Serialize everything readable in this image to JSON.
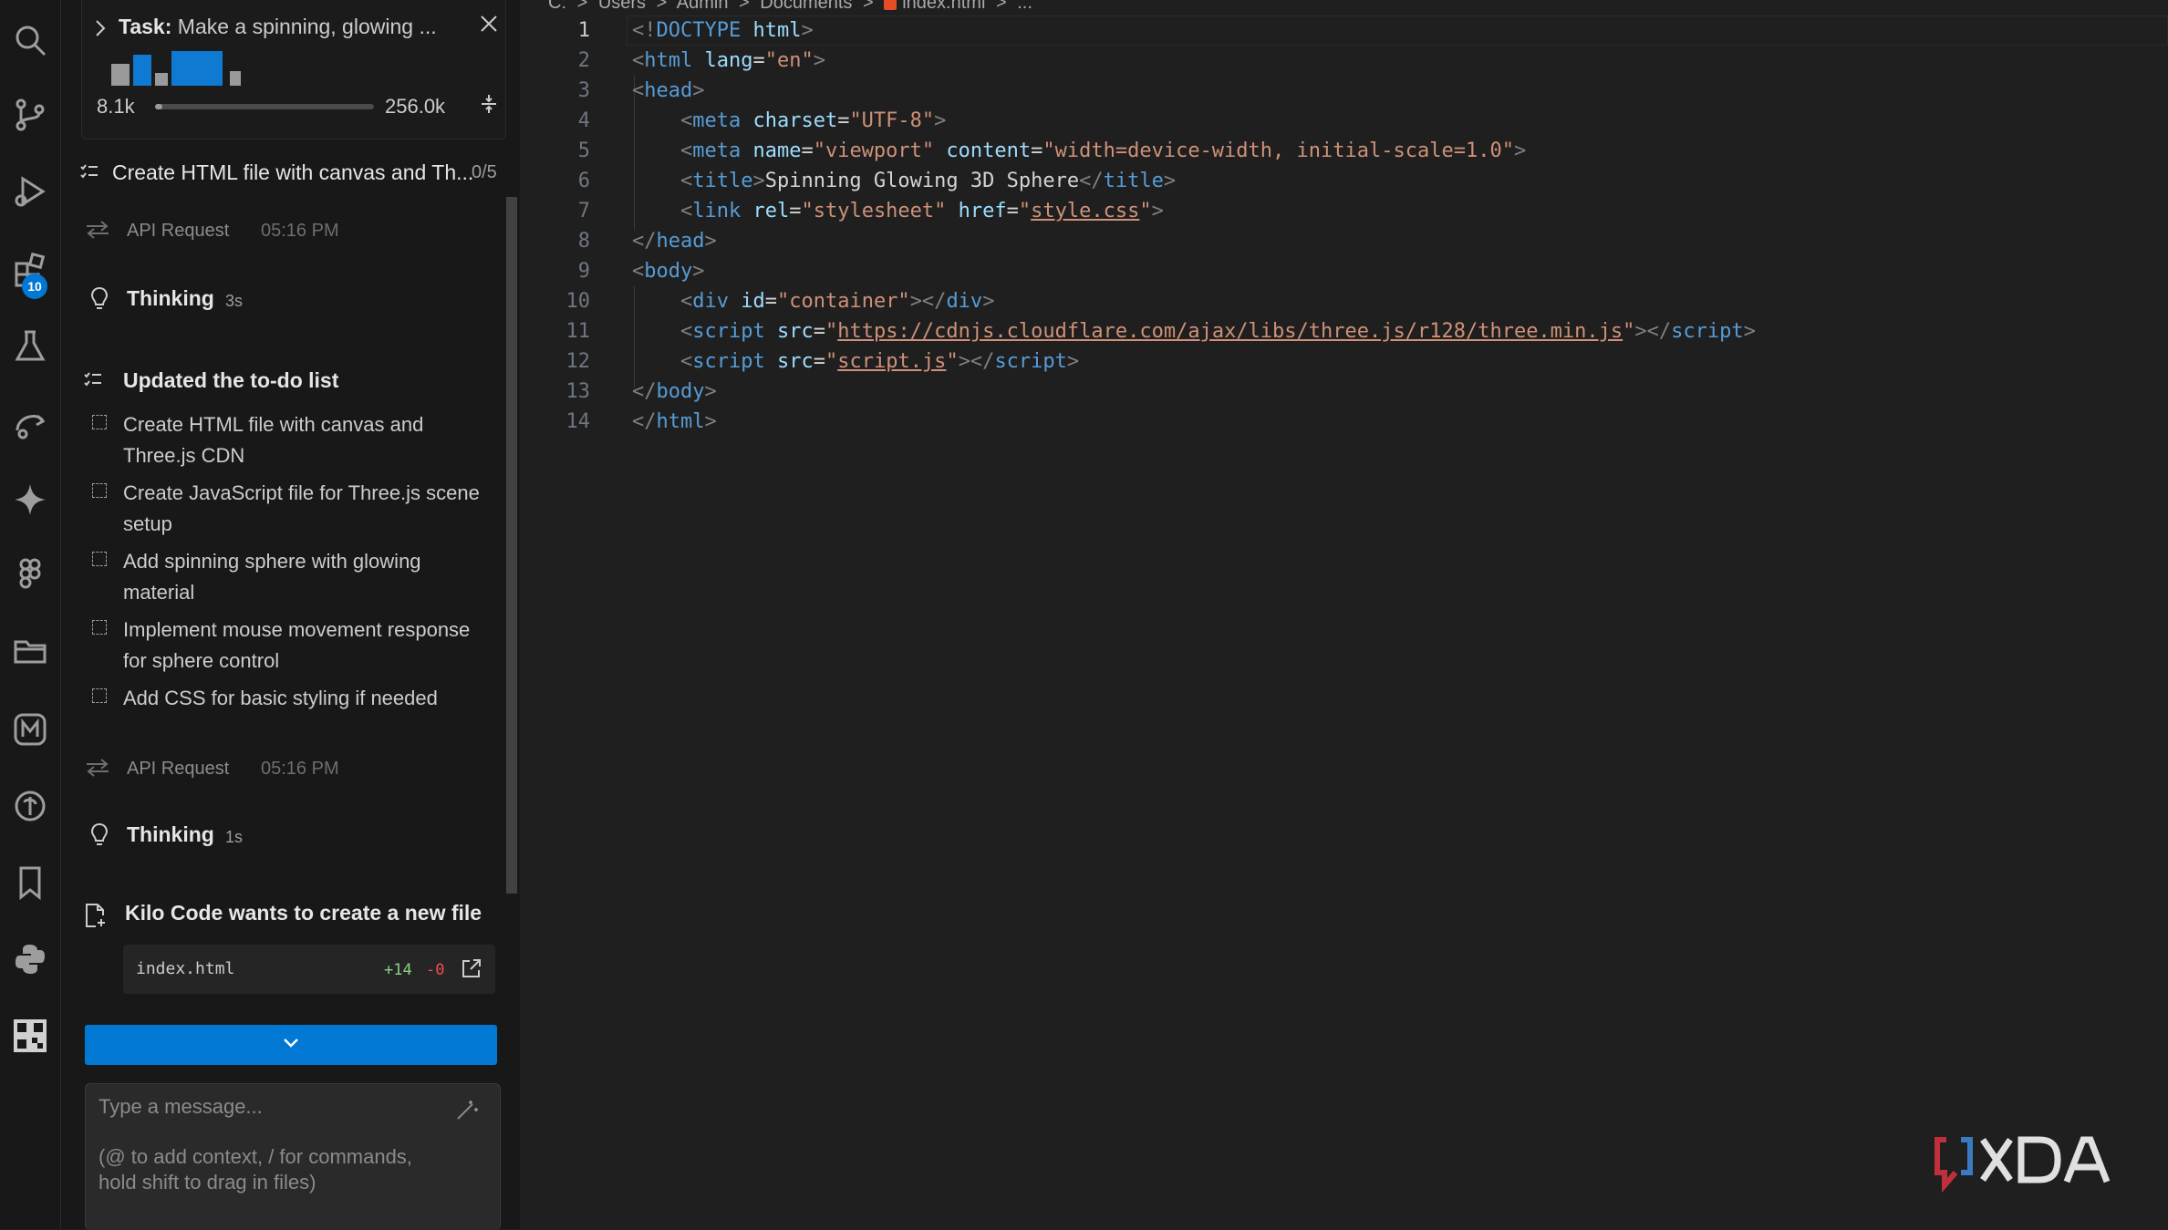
{
  "activity_bar": {
    "icons": [
      "search-icon",
      "source-control-icon",
      "run-debug-icon",
      "extensions-icon",
      "testing-icon",
      "remote-icon",
      "ai-sparkle-icon",
      "figma-icon",
      "folder-icon",
      "kilo-icon",
      "accounts-icon",
      "bookmark-icon",
      "python-icon",
      "qr-icon"
    ],
    "extensions_badge": "10"
  },
  "task": {
    "label": "Task:",
    "text": "Make a spinning, glowing ...",
    "context_used": "8.1k",
    "context_max": "256.0k",
    "context_fill_fraction": 0.032
  },
  "todo_summary": {
    "text": "Create HTML file with canvas and Th...",
    "count": "0/5"
  },
  "feed": {
    "api1": {
      "label": "API Request",
      "time": "05:16 PM"
    },
    "think1": {
      "label": "Thinking",
      "duration": "3s"
    },
    "updated_label": "Updated the to-do list",
    "todos": [
      "Create HTML file with canvas and Three.js CDN",
      "Create JavaScript file for Three.js scene setup",
      "Add spinning sphere with glowing material",
      "Implement mouse movement response for sphere control",
      "Add CSS for basic styling if needed"
    ],
    "api2": {
      "label": "API Request",
      "time": "05:16 PM"
    },
    "think2": {
      "label": "Thinking",
      "duration": "1s"
    },
    "create_file_label": "Kilo Code wants to create a new file",
    "file": {
      "name": "index.html",
      "added": "+14",
      "removed": "-0"
    }
  },
  "input": {
    "placeholder_line1": "Type a message...",
    "placeholder_line2": "(@ to add context, / for commands, hold shift to drag in files)"
  },
  "breadcrumb": [
    "C:",
    ">",
    "Users",
    ">",
    "Admin",
    ">",
    "Documents",
    ">",
    "index.html",
    ">",
    "..."
  ],
  "editor": {
    "active_line": 1,
    "lines": [
      {
        "n": "1",
        "tokens": [
          [
            "p",
            "<!"
          ],
          [
            "t",
            "DOCTYPE"
          ],
          [
            "x",
            " "
          ],
          [
            "a",
            "html"
          ],
          [
            "p",
            ">"
          ]
        ]
      },
      {
        "n": "2",
        "tokens": [
          [
            "p",
            "<"
          ],
          [
            "t",
            "html"
          ],
          [
            "x",
            " "
          ],
          [
            "a",
            "lang"
          ],
          [
            "x",
            "="
          ],
          [
            "s",
            "\"en\""
          ],
          [
            "p",
            ">"
          ]
        ]
      },
      {
        "n": "3",
        "tokens": [
          [
            "p",
            "<"
          ],
          [
            "t",
            "head"
          ],
          [
            "p",
            ">"
          ]
        ]
      },
      {
        "n": "4",
        "tokens": [
          [
            "x",
            "    "
          ],
          [
            "p",
            "<"
          ],
          [
            "t",
            "meta"
          ],
          [
            "x",
            " "
          ],
          [
            "a",
            "charset"
          ],
          [
            "x",
            "="
          ],
          [
            "s",
            "\"UTF-8\""
          ],
          [
            "p",
            ">"
          ]
        ]
      },
      {
        "n": "5",
        "tokens": [
          [
            "x",
            "    "
          ],
          [
            "p",
            "<"
          ],
          [
            "t",
            "meta"
          ],
          [
            "x",
            " "
          ],
          [
            "a",
            "name"
          ],
          [
            "x",
            "="
          ],
          [
            "s",
            "\"viewport\""
          ],
          [
            "x",
            " "
          ],
          [
            "a",
            "content"
          ],
          [
            "x",
            "="
          ],
          [
            "s",
            "\"width=device-width, initial-scale=1.0\""
          ],
          [
            "p",
            ">"
          ]
        ]
      },
      {
        "n": "6",
        "tokens": [
          [
            "x",
            "    "
          ],
          [
            "p",
            "<"
          ],
          [
            "t",
            "title"
          ],
          [
            "p",
            ">"
          ],
          [
            "x",
            "Spinning Glowing 3D Sphere"
          ],
          [
            "p",
            "</"
          ],
          [
            "t",
            "title"
          ],
          [
            "p",
            ">"
          ]
        ]
      },
      {
        "n": "7",
        "tokens": [
          [
            "x",
            "    "
          ],
          [
            "p",
            "<"
          ],
          [
            "t",
            "link"
          ],
          [
            "x",
            " "
          ],
          [
            "a",
            "rel"
          ],
          [
            "x",
            "="
          ],
          [
            "s",
            "\"stylesheet\""
          ],
          [
            "x",
            " "
          ],
          [
            "a",
            "href"
          ],
          [
            "x",
            "="
          ],
          [
            "s",
            "\""
          ],
          [
            "su",
            "style.css"
          ],
          [
            "s",
            "\""
          ],
          [
            "p",
            ">"
          ]
        ]
      },
      {
        "n": "8",
        "tokens": [
          [
            "p",
            "</"
          ],
          [
            "t",
            "head"
          ],
          [
            "p",
            ">"
          ]
        ]
      },
      {
        "n": "9",
        "tokens": [
          [
            "p",
            "<"
          ],
          [
            "t",
            "body"
          ],
          [
            "p",
            ">"
          ]
        ]
      },
      {
        "n": "10",
        "tokens": [
          [
            "x",
            "    "
          ],
          [
            "p",
            "<"
          ],
          [
            "t",
            "div"
          ],
          [
            "x",
            " "
          ],
          [
            "a",
            "id"
          ],
          [
            "x",
            "="
          ],
          [
            "s",
            "\"container\""
          ],
          [
            "p",
            "></"
          ],
          [
            "t",
            "div"
          ],
          [
            "p",
            ">"
          ]
        ]
      },
      {
        "n": "11",
        "tokens": [
          [
            "x",
            "    "
          ],
          [
            "p",
            "<"
          ],
          [
            "t",
            "script"
          ],
          [
            "x",
            " "
          ],
          [
            "a",
            "src"
          ],
          [
            "x",
            "="
          ],
          [
            "s",
            "\""
          ],
          [
            "su",
            "https://cdnjs.cloudflare.com/ajax/libs/three.js/r128/three.min.js"
          ],
          [
            "s",
            "\""
          ],
          [
            "p",
            "></"
          ],
          [
            "t",
            "script"
          ],
          [
            "p",
            ">"
          ]
        ]
      },
      {
        "n": "12",
        "tokens": [
          [
            "x",
            "    "
          ],
          [
            "p",
            "<"
          ],
          [
            "t",
            "script"
          ],
          [
            "x",
            " "
          ],
          [
            "a",
            "src"
          ],
          [
            "x",
            "="
          ],
          [
            "s",
            "\""
          ],
          [
            "su",
            "script.js"
          ],
          [
            "s",
            "\""
          ],
          [
            "p",
            "></"
          ],
          [
            "t",
            "script"
          ],
          [
            "p",
            ">"
          ]
        ]
      },
      {
        "n": "13",
        "tokens": [
          [
            "p",
            "</"
          ],
          [
            "t",
            "body"
          ],
          [
            "p",
            ">"
          ]
        ]
      },
      {
        "n": "14",
        "tokens": [
          [
            "p",
            "</"
          ],
          [
            "t",
            "html"
          ],
          [
            "p",
            ">"
          ]
        ]
      }
    ]
  },
  "watermark": {
    "text": "XDA"
  },
  "colors": {
    "accent": "#0078d4",
    "added": "#89d185",
    "removed": "#f14c4c"
  }
}
